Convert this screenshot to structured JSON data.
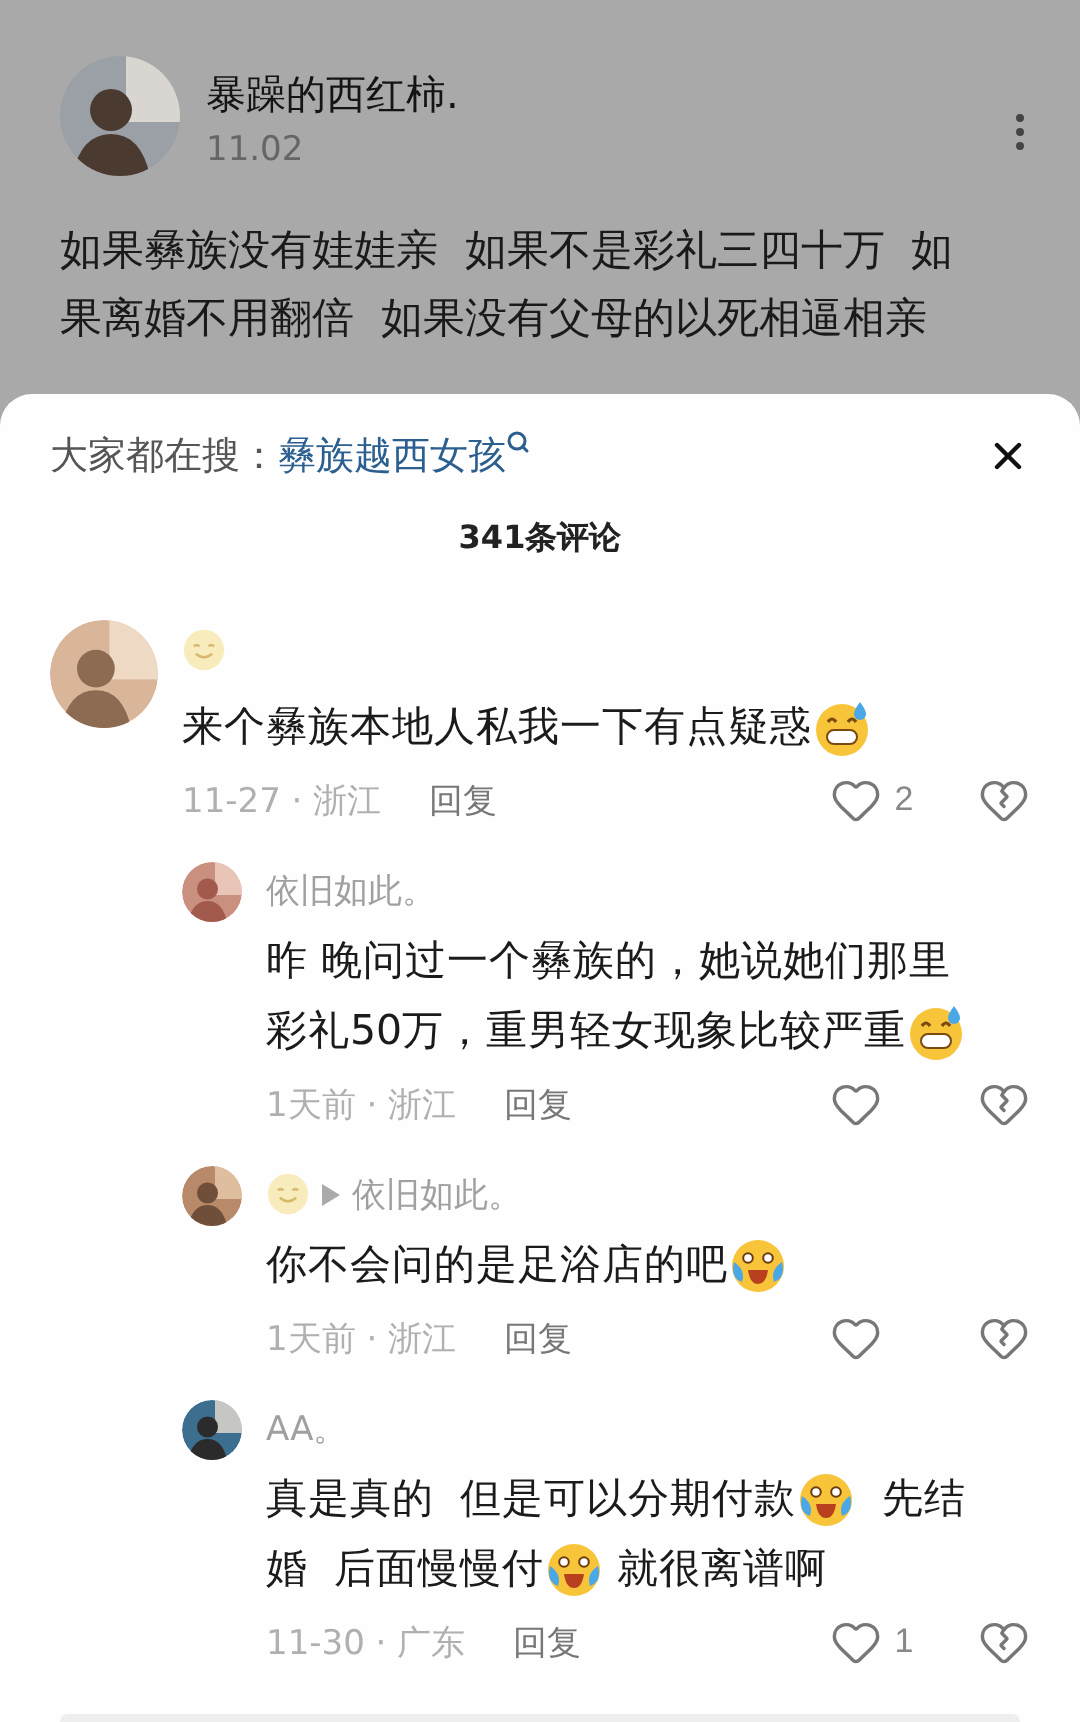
{
  "post": {
    "author": "暴躁的西红柿.",
    "date": "11.02",
    "body_lines": [
      "如果彝族没有娃娃亲  如果不是彩礼三四十万  如",
      "果离婚不用翻倍  如果没有父母的以死相逼相亲"
    ]
  },
  "sheet": {
    "search_label": "大家都在搜：",
    "search_term": "彝族越西女孩",
    "comment_count": "341条评论",
    "comments": [
      {
        "author": [
          {
            "kind": "smile"
          }
        ],
        "lines": [
          [
            {
              "kind": "text",
              "text": "来个彝族本地人私我一下有点疑惑"
            },
            {
              "kind": "grin-sweat"
            }
          ]
        ],
        "meta": "11-27 · 浙江",
        "reply": "回复",
        "likes": "2",
        "replies": [
          {
            "author": [
              {
                "kind": "text",
                "text": "依旧如此。"
              }
            ],
            "lines": [
              [
                {
                  "kind": "text",
                  "text": "昨 晚问过一个彝族的，她说她们那里"
                }
              ],
              [
                {
                  "kind": "text",
                  "text": "彩礼50万，重男轻女现象比较严重"
                },
                {
                  "kind": "grin-sweat"
                }
              ]
            ],
            "meta": "1天前 · 浙江",
            "reply": "回复"
          },
          {
            "author": [
              {
                "kind": "smile"
              },
              {
                "kind": "arrow"
              },
              {
                "kind": "text",
                "text": "依旧如此。"
              }
            ],
            "lines": [
              [
                {
                  "kind": "text",
                  "text": "你不会问的是足浴店的吧"
                },
                {
                  "kind": "tears-joy"
                }
              ]
            ],
            "meta": "1天前 · 浙江",
            "reply": "回复"
          },
          {
            "author": [
              {
                "kind": "text",
                "text": "AA。"
              }
            ],
            "lines": [
              [
                {
                  "kind": "text",
                  "text": "真是真的  但是可以分期付款"
                },
                {
                  "kind": "tears-joy"
                },
                {
                  "kind": "text",
                  "text": "  先结"
                }
              ],
              [
                {
                  "kind": "text",
                  "text": "婚  后面慢慢付"
                },
                {
                  "kind": "tears-joy"
                },
                {
                  "kind": "text",
                  "text": " 就很离谱啊"
                }
              ]
            ],
            "meta": "11-30 · 广东",
            "reply": "回复",
            "likes": "1"
          }
        ]
      }
    ]
  }
}
